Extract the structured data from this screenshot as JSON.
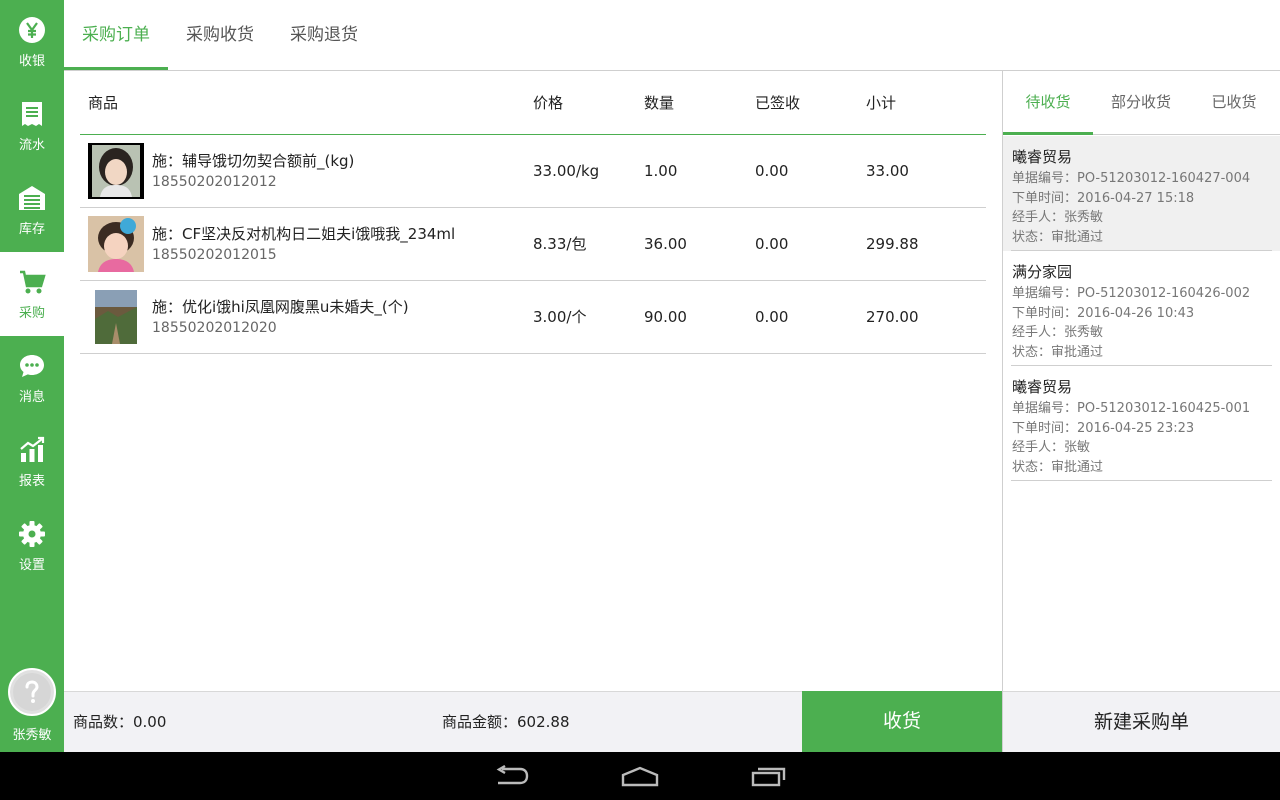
{
  "sidebar": {
    "items": [
      {
        "label": "收银",
        "icon": "yen-icon"
      },
      {
        "label": "流水",
        "icon": "receipt-icon"
      },
      {
        "label": "库存",
        "icon": "warehouse-icon"
      },
      {
        "label": "采购",
        "icon": "cart-icon",
        "active": true
      },
      {
        "label": "消息",
        "icon": "chat-icon"
      },
      {
        "label": "报表",
        "icon": "chart-icon"
      },
      {
        "label": "设置",
        "icon": "gear-icon"
      }
    ],
    "user": {
      "name": "张秀敏",
      "avatar": "unknown-user-icon"
    }
  },
  "top_tabs": [
    {
      "label": "采购订单",
      "active": true
    },
    {
      "label": "采购收货"
    },
    {
      "label": "采购退货"
    }
  ],
  "table": {
    "headers": [
      "商品",
      "价格",
      "数量",
      "已签收",
      "小计"
    ],
    "rows": [
      {
        "name": "施：辅导饿切勿契合额前_(kg)",
        "code": "18550202012012",
        "price": "33.00/kg",
        "qty": "1.00",
        "signed": "0.00",
        "subtotal": "33.00"
      },
      {
        "name": "施：CF坚决反对机构日二姐夫i饿哦我_234ml",
        "code": "18550202012015",
        "price": "8.33/包",
        "qty": "36.00",
        "signed": "0.00",
        "subtotal": "299.88"
      },
      {
        "name": "施：优化i饿hi凤凰网腹黑u未婚夫_(个)",
        "code": "18550202012020",
        "price": "3.00/个",
        "qty": "90.00",
        "signed": "0.00",
        "subtotal": "270.00"
      }
    ]
  },
  "right_tabs": [
    {
      "label": "待收货",
      "active": true
    },
    {
      "label": "部分收货"
    },
    {
      "label": "已收货"
    }
  ],
  "orders": [
    {
      "supplier": "曦睿贸易",
      "number": "单据编号：PO-51203012-160427-004",
      "time": "下单时间：2016-04-27 15:18",
      "handler": "经手人：张秀敏",
      "status": "状态：审批通过",
      "selected": true
    },
    {
      "supplier": "满分家园",
      "number": "单据编号：PO-51203012-160426-002",
      "time": "下单时间：2016-04-26 10:43",
      "handler": "经手人：张秀敏",
      "status": "状态：审批通过"
    },
    {
      "supplier": "曦睿贸易",
      "number": "单据编号：PO-51203012-160425-001",
      "time": "下单时间：2016-04-25 23:23",
      "handler": "经手人：张敏",
      "status": "状态：审批通过"
    }
  ],
  "footer": {
    "item_count": "商品数：0.00",
    "amount": "商品金额：602.88",
    "receive_label": "收货",
    "new_order_label": "新建采购单"
  },
  "colors": {
    "accent": "#4caf50",
    "sidebar_bg": "#4caf50",
    "footer_bg": "#f2f2f5"
  }
}
